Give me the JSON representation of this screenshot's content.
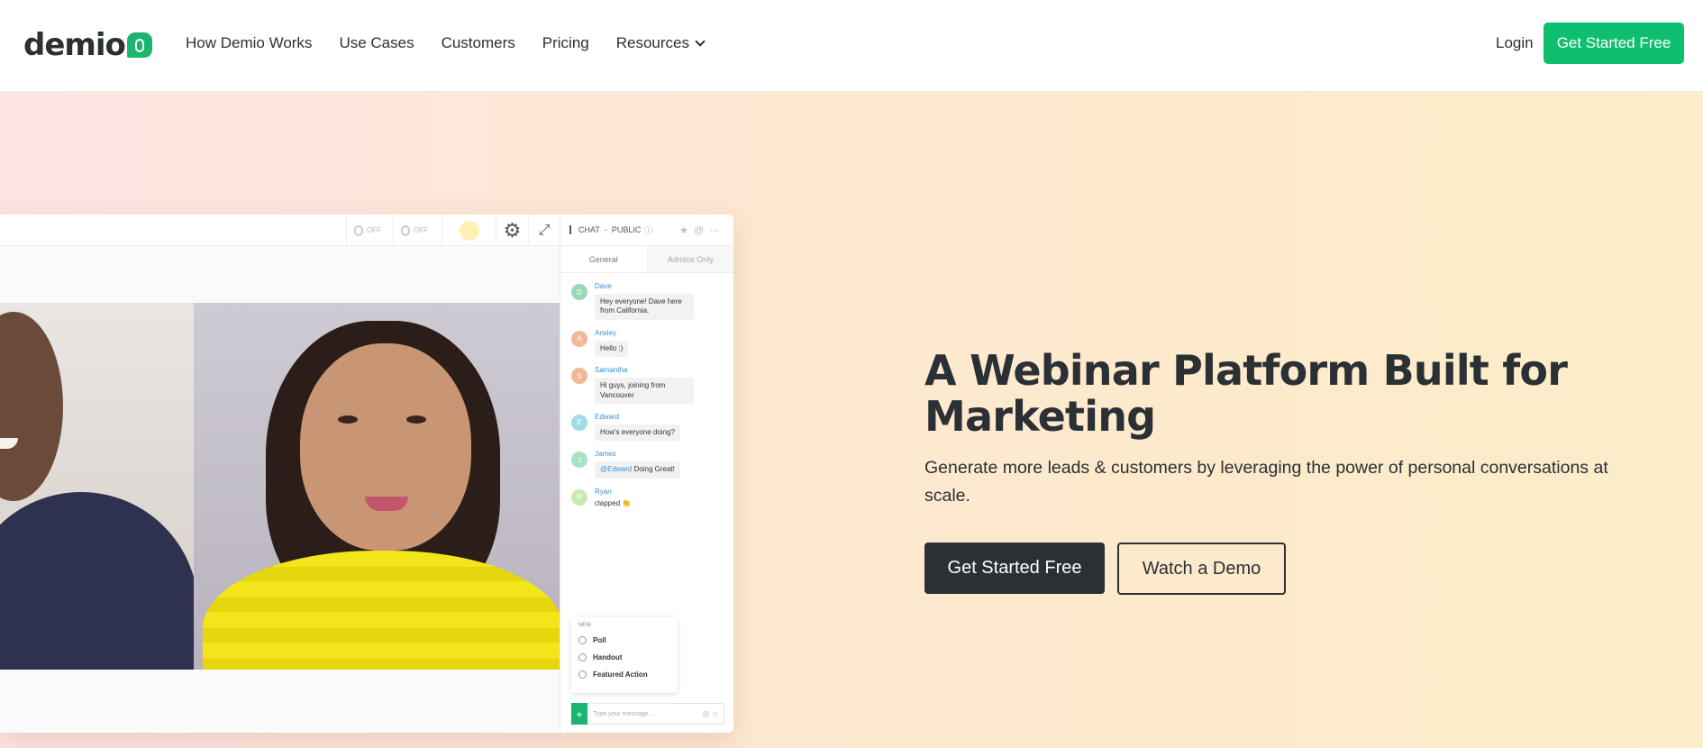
{
  "brand": {
    "name": "demio",
    "accent": "#0dbf6e"
  },
  "nav": {
    "links": [
      "How Demio Works",
      "Use Cases",
      "Customers",
      "Pricing",
      "Resources"
    ],
    "login": "Login",
    "cta": "Get Started Free"
  },
  "app": {
    "toolbar": {
      "mic": "OFF",
      "cam": "OFF"
    },
    "chat": {
      "title": "CHAT",
      "scope": "PUBLIC",
      "tabs": [
        "General",
        "Admins Only"
      ],
      "messages": [
        {
          "initial": "D",
          "name": "Dave",
          "text": "Hey everyone! Dave here from California.",
          "color": "#9ed9b5"
        },
        {
          "initial": "A",
          "name": "Ansley",
          "text": "Hello :)",
          "color": "#f3b89b"
        },
        {
          "initial": "S",
          "name": "Samantha",
          "text": "Hi guys, joining from Vancouver",
          "color": "#f0b895"
        },
        {
          "initial": "E",
          "name": "Edward",
          "text": "How's everyone doing?",
          "color": "#9fdce8"
        },
        {
          "initial": "J",
          "name": "James",
          "mention": "@Edward",
          "text": "Doing Great!",
          "color": "#a7e3c1"
        },
        {
          "initial": "R",
          "name": "Ryan",
          "text": "clapped 👏",
          "color": "#c7ecae"
        }
      ],
      "new_menu": {
        "label": "NEW",
        "items": [
          "Poll",
          "Handout",
          "Featured Action"
        ]
      },
      "input_placeholder": "Type your message..."
    }
  },
  "hero": {
    "title": "A Webinar Platform Built for Marketing",
    "subtitle": "Generate more leads & customers by leveraging the power of personal conversations at scale.",
    "primary_cta": "Get Started Free",
    "secondary_cta": "Watch a Demo"
  }
}
